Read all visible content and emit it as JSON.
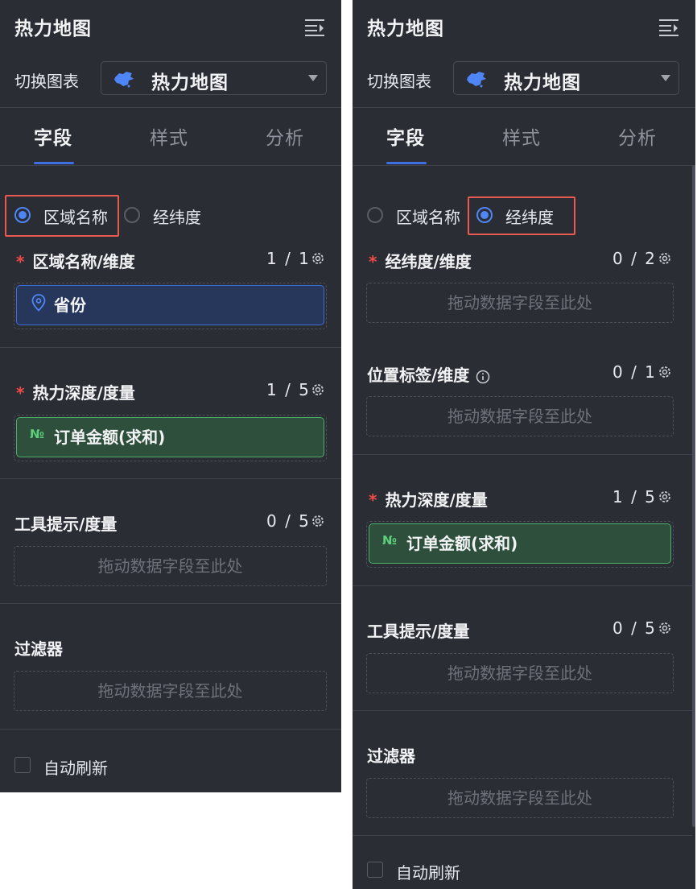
{
  "left_panel": {
    "title": "热力地图",
    "switch_chart_label": "切换图表",
    "chart_select_value": "热力地图",
    "tabs": [
      "字段",
      "样式",
      "分析"
    ],
    "radio_region": "区域名称",
    "radio_latlng": "经纬度",
    "selected_radio": "区域名称",
    "region_section": {
      "label": "区域名称/维度",
      "count": "1 / 1",
      "pill": "省份"
    },
    "heat_section": {
      "label": "热力深度/度量",
      "count": "1 / 5",
      "pill": "订单金额(求和)",
      "pill_icon": "№"
    },
    "tooltip_section": {
      "label": "工具提示/度量",
      "count": "0 / 5",
      "dropzone": "拖动数据字段至此处"
    },
    "filter_section": {
      "label": "过滤器",
      "dropzone": "拖动数据字段至此处"
    },
    "auto_refresh": "自动刷新"
  },
  "right_panel": {
    "title": "热力地图",
    "switch_chart_label": "切换图表",
    "chart_select_value": "热力地图",
    "tabs": [
      "字段",
      "样式",
      "分析"
    ],
    "radio_region": "区域名称",
    "radio_latlng": "经纬度",
    "selected_radio": "经纬度",
    "latlng_section": {
      "label": "经纬度/维度",
      "count": "0 / 2",
      "dropzone": "拖动数据字段至此处"
    },
    "location_section": {
      "label": "位置标签/维度",
      "count": "0 / 1",
      "dropzone": "拖动数据字段至此处"
    },
    "heat_section": {
      "label": "热力深度/度量",
      "count": "1 / 5",
      "pill": "订单金额(求和)",
      "pill_icon": "№"
    },
    "tooltip_section": {
      "label": "工具提示/度量",
      "count": "0 / 5",
      "dropzone": "拖动数据字段至此处"
    },
    "filter_section": {
      "label": "过滤器",
      "dropzone": "拖动数据字段至此处"
    },
    "auto_refresh": "自动刷新"
  },
  "colors": {
    "panel_bg": "#2b2d35",
    "accent_blue": "#4f86f7",
    "highlight_red": "#e85a4f",
    "measure_green": "#4fae6a",
    "required_red": "#ee4b47"
  }
}
